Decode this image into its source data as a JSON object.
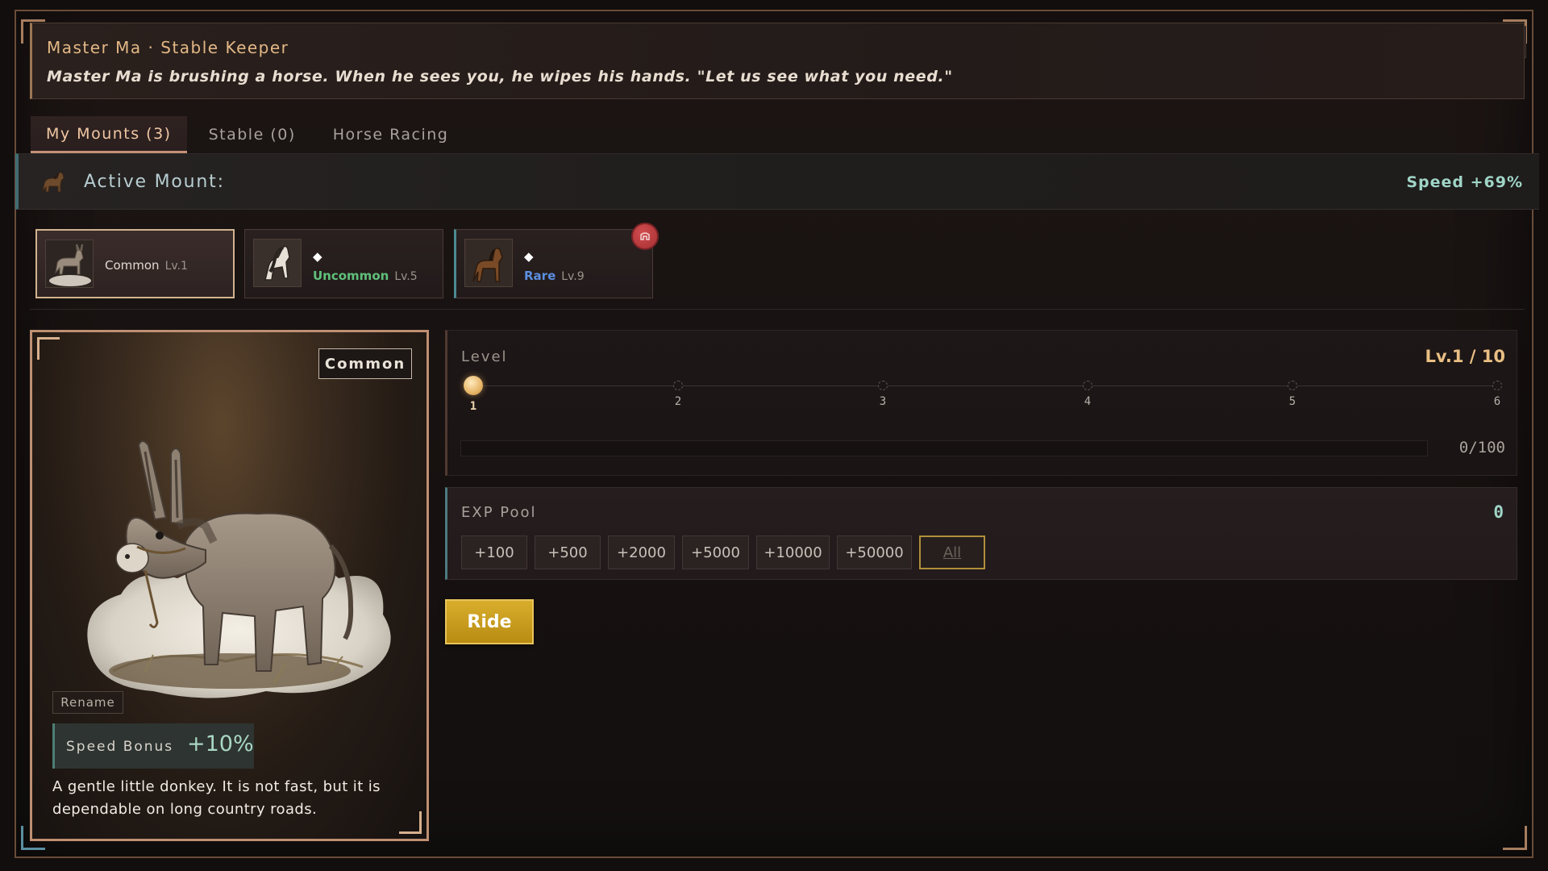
{
  "dialog": {
    "npc_name": "Master Ma · Stable Keeper",
    "line": "Master Ma is brushing a horse. When he sees you, he wipes his hands. \"Let us see what you need.\""
  },
  "close_icon": "close-icon",
  "tabs": [
    {
      "label": "My Mounts (3)",
      "active": true
    },
    {
      "label": "Stable (0)",
      "active": false
    },
    {
      "label": "Horse Racing",
      "active": false
    }
  ],
  "active_mount": {
    "label": "Active Mount:",
    "speed_text": "Speed  +69%"
  },
  "mounts": [
    {
      "rarity": "Common",
      "level": "Lv.1",
      "rarity_color": "#e0d8cf",
      "selected": true,
      "diamond": false
    },
    {
      "rarity": "Uncommon",
      "level": "Lv.5",
      "rarity_color": "#5fc07a",
      "selected": false,
      "diamond": true,
      "diamond_glyph": "◆"
    },
    {
      "rarity": "Rare",
      "level": "Lv.9",
      "rarity_color": "#5b8fe0",
      "selected": false,
      "diamond": true,
      "diamond_glyph": "◆",
      "riding_badge": true
    }
  ],
  "detail": {
    "rarity_tag": "Common",
    "rename": "Rename",
    "speed_bonus_label": "Speed Bonus",
    "speed_bonus_value": "+10%",
    "description": "A gentle little donkey. It is not fast, but it is dependable on long country roads."
  },
  "level": {
    "label": "Level",
    "value": "Lv.1 / 10",
    "current": 1,
    "nodes": [
      "1",
      "2",
      "3",
      "4",
      "5",
      "6"
    ],
    "exp_text": "0/100",
    "exp_fraction": 0
  },
  "exp_pool": {
    "label": "EXP Pool",
    "value": "0",
    "buttons": [
      "+100",
      "+500",
      "+2000",
      "+5000",
      "+10000",
      "+50000",
      "All"
    ]
  },
  "ride_label": "Ride"
}
